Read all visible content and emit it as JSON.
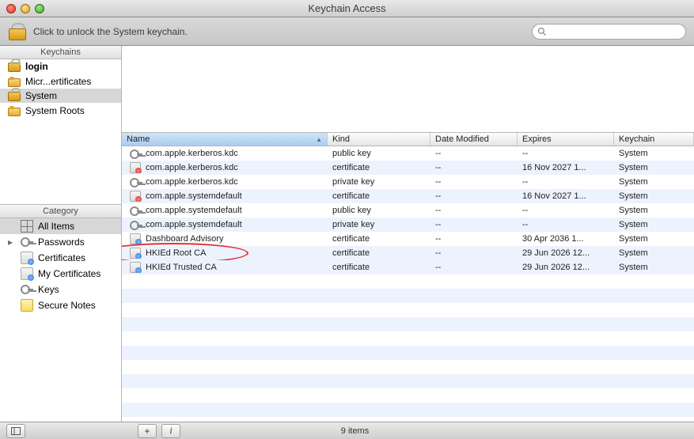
{
  "window": {
    "title": "Keychain Access"
  },
  "toolbar": {
    "lock_text": "Click to unlock the System keychain.",
    "search_placeholder": ""
  },
  "sidebar": {
    "keychains_header": "Keychains",
    "category_header": "Category",
    "keychains": [
      {
        "label": "login",
        "icon": "login",
        "bold": true
      },
      {
        "label": "Micr...ertificates",
        "icon": "folder"
      },
      {
        "label": "System",
        "icon": "login",
        "selected": true
      },
      {
        "label": "System Roots",
        "icon": "folder"
      }
    ],
    "categories": [
      {
        "label": "All Items",
        "icon": "grid",
        "selected": true,
        "indent": 1
      },
      {
        "label": "Passwords",
        "icon": "key",
        "indent": 1,
        "arrow": true
      },
      {
        "label": "Certificates",
        "icon": "cert",
        "indent": 1
      },
      {
        "label": "My Certificates",
        "icon": "cert",
        "indent": 1
      },
      {
        "label": "Keys",
        "icon": "key",
        "indent": 1
      },
      {
        "label": "Secure Notes",
        "icon": "note",
        "indent": 1
      }
    ]
  },
  "table": {
    "columns": {
      "name": "Name",
      "kind": "Kind",
      "date": "Date Modified",
      "exp": "Expires",
      "kc": "Keychain"
    },
    "sorted_column": "name",
    "rows": [
      {
        "name": "com.apple.kerberos.kdc",
        "kind": "public key",
        "date": "--",
        "exp": "--",
        "kc": "System",
        "icon": "key"
      },
      {
        "name": "com.apple.kerberos.kdc",
        "kind": "certificate",
        "date": "--",
        "exp": "16 Nov 2027 1...",
        "kc": "System",
        "icon": "cert-bad"
      },
      {
        "name": "com.apple.kerberos.kdc",
        "kind": "private key",
        "date": "--",
        "exp": "--",
        "kc": "System",
        "icon": "key"
      },
      {
        "name": "com.apple.systemdefault",
        "kind": "certificate",
        "date": "--",
        "exp": "16 Nov 2027 1...",
        "kc": "System",
        "icon": "cert-bad"
      },
      {
        "name": "com.apple.systemdefault",
        "kind": "public key",
        "date": "--",
        "exp": "--",
        "kc": "System",
        "icon": "key"
      },
      {
        "name": "com.apple.systemdefault",
        "kind": "private key",
        "date": "--",
        "exp": "--",
        "kc": "System",
        "icon": "key"
      },
      {
        "name": "Dashboard Advisory",
        "kind": "certificate",
        "date": "--",
        "exp": "30 Apr 2036 1...",
        "kc": "System",
        "icon": "cert"
      },
      {
        "name": "HKIEd Root CA",
        "kind": "certificate",
        "date": "--",
        "exp": "29 Jun 2026 12...",
        "kc": "System",
        "icon": "cert",
        "annot": true
      },
      {
        "name": "HKIEd Trusted CA",
        "kind": "certificate",
        "date": "--",
        "exp": "29 Jun 2026 12...",
        "kc": "System",
        "icon": "cert"
      }
    ]
  },
  "footer": {
    "count_text": "9 items"
  }
}
